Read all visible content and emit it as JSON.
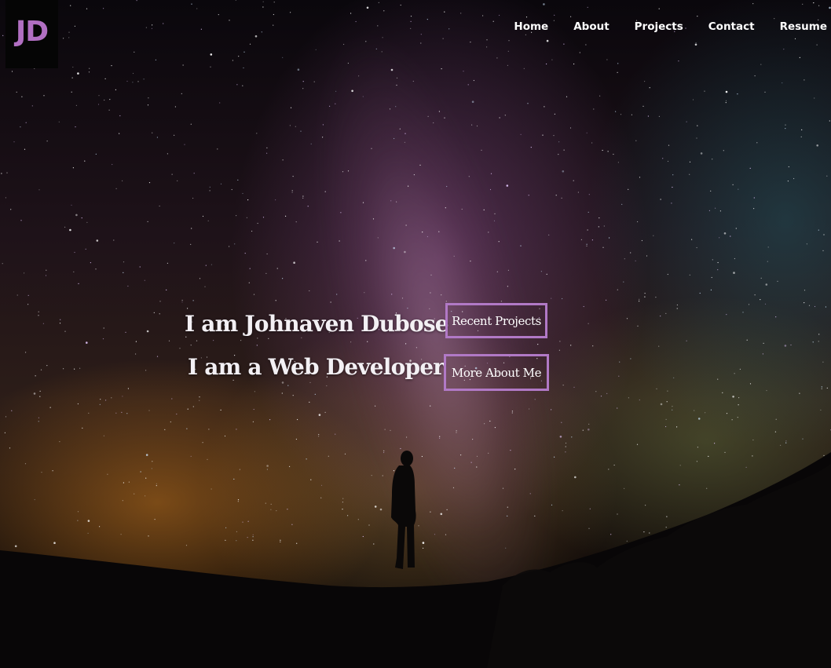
{
  "header": {
    "logo": "JD",
    "nav": [
      {
        "label": "Home"
      },
      {
        "label": "About"
      },
      {
        "label": "Projects"
      },
      {
        "label": "Contact"
      },
      {
        "label": "Resume"
      }
    ]
  },
  "hero": {
    "line1": "I am Johnaven Dubose",
    "line2": "I am a Web Developer",
    "buttons": {
      "recent_projects": "Recent Projects",
      "more_about_me": "More About Me"
    }
  },
  "colors": {
    "accent": "#b179c6",
    "logo": "#b16fc2",
    "text": "#ffffff"
  },
  "background": {
    "image": "night-sky-milky-way-silhouette"
  }
}
